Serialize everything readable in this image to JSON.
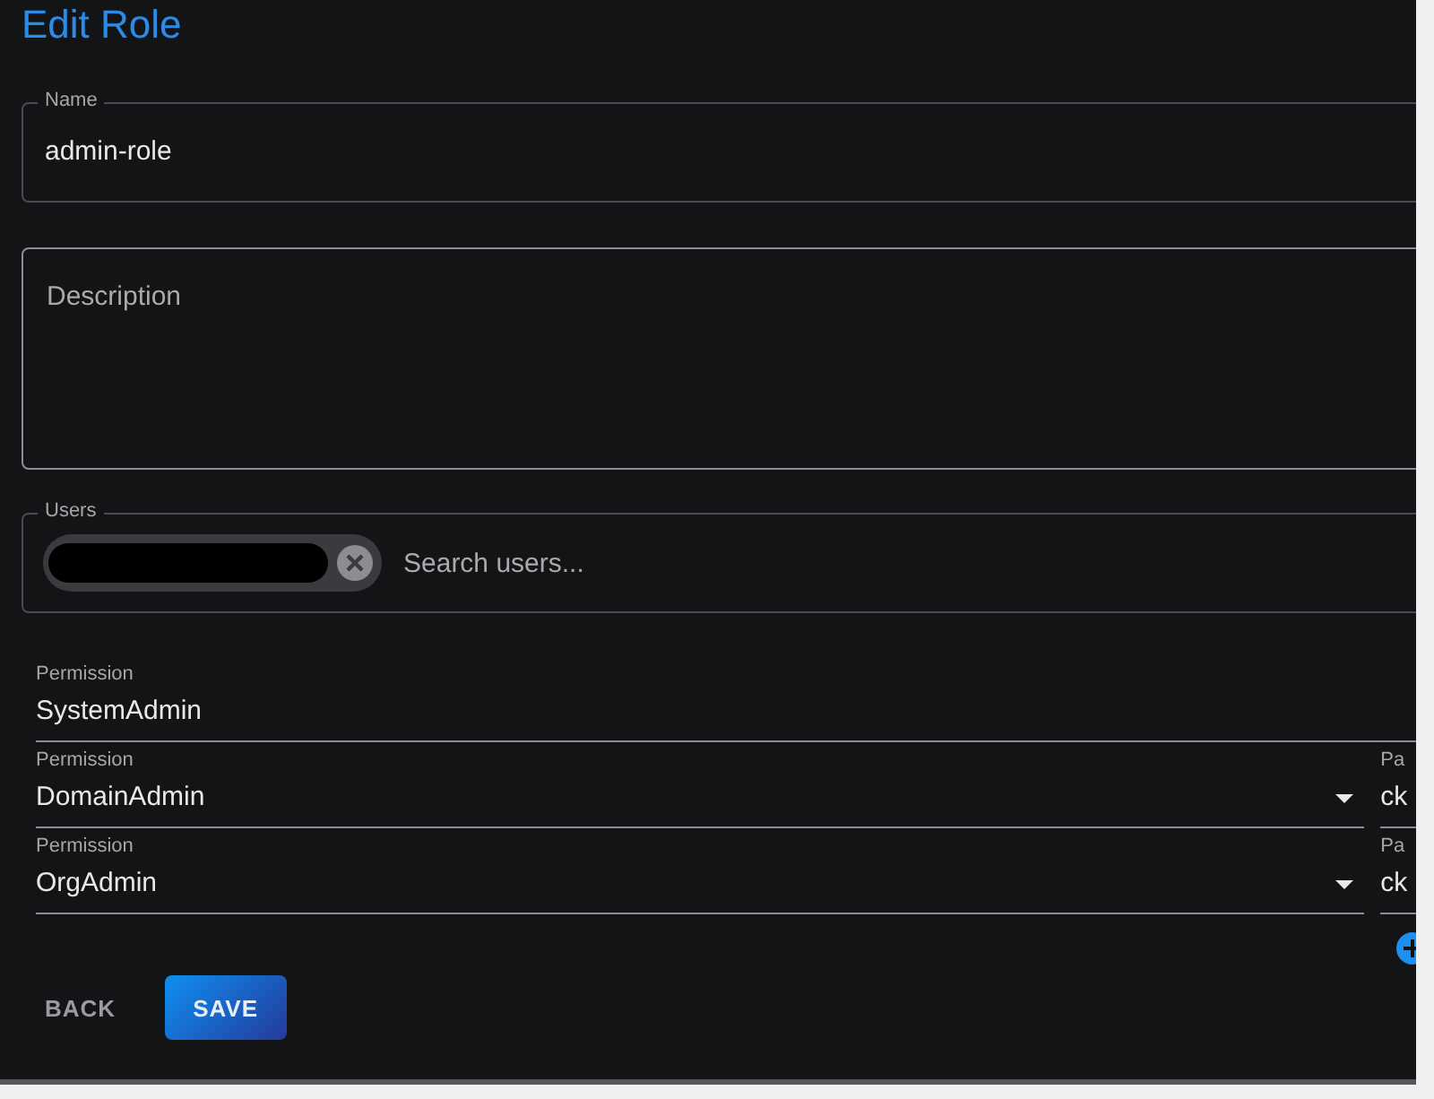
{
  "title": "Edit Role",
  "name_field": {
    "label": "Name",
    "value": "admin-role"
  },
  "description_field": {
    "placeholder": "Description"
  },
  "users_field": {
    "label": "Users",
    "placeholder": "Search users...",
    "chips": [
      {
        "kind": "redacted"
      }
    ]
  },
  "permissions": [
    {
      "kind": "plain",
      "label": "Permission",
      "value": "SystemAdmin"
    },
    {
      "kind": "select",
      "label": "Permission",
      "value": "DomainAdmin",
      "param_label": "Pa",
      "param_value": "ck"
    },
    {
      "kind": "select",
      "label": "Permission",
      "value": "OrgAdmin",
      "param_label": "Pa",
      "param_value": "ck"
    }
  ],
  "buttons": [
    {
      "kind": "text",
      "label": "BACK"
    },
    {
      "kind": "contained",
      "label": "SAVE"
    }
  ]
}
